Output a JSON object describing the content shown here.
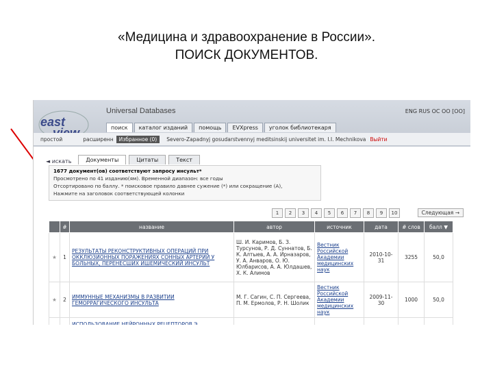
{
  "slide": {
    "title_line1": "«Медицина и здравоохранение в России».",
    "title_line2": "ПОИСК ДОКУМЕНТОВ."
  },
  "app": {
    "brand": "Universal Databases",
    "lang_line": "ENG RUS  ОС  ОО  [ОО]",
    "lang_selected": "RUS"
  },
  "nav_tabs": [
    "поиск",
    "каталог изданий",
    "помощь",
    "EVXpress",
    "уголок библиотекаря"
  ],
  "subbar": {
    "simple": "простой",
    "extended": "расширенн",
    "favorites": "Избранное (0)",
    "org": "Severo-Zapadnyj gosudarstvennyj meditsinskij universitet im. I.I. Mechnikova",
    "exit": "Выйти"
  },
  "result_tabs": {
    "back": "◄ искать",
    "items": [
      "Документы",
      "Цитаты",
      "Текст"
    ]
  },
  "results_info": {
    "line1": "1677 документ(ов) соответствуют запросу инсульт*",
    "line2": "Просмотрено по 41 изданию(ям). Временной диапазон: все годы",
    "line3": "Отсортировано по баллу. * поисковое правило давнее сужение (*) или сокращение (А),",
    "line4": "Нажмите на заголовок соответствующей колонки"
  },
  "pager": [
    "1",
    "2",
    "3",
    "4",
    "5",
    "6",
    "7",
    "8",
    "9",
    "10"
  ],
  "next_label": "Следующая →",
  "table": {
    "headers": [
      "",
      "#",
      "название",
      "автор",
      "источник",
      "дата",
      "# слов",
      "балл ▼"
    ],
    "rows": [
      {
        "num": "1",
        "title": "РЕЗУЛЬТАТЫ РЕКОНСТРУКТИВНЫХ ОПЕРАЦИЙ ПРИ ОККЛЮЗИОННЫХ ПОРАЖЕНИЯХ СОННЫХ АРТЕРИЙ У БОЛЬНЫХ, ПЕРЕНЕСШИХ ИШЕМИЧЕСКИЙ ИНСУЛЬТ",
        "author": "Ш. И. Каримов, Б. З. Турсунов, Р. Д. Суннатов, Б. К. Алтыев, А. А. Ирназаров, У. А. Анваров, О. Ю. Юлбарисов, А. А. Юлдашев, Х. К. Алимов",
        "source": "Вестник Российской Академии медицинских наук",
        "date": "2010-10-31",
        "words": "3255",
        "score": "50,0"
      },
      {
        "num": "2",
        "title": "ИММУННЫЕ МЕХАНИЗМЫ В РАЗВИТИИ ГЕМОРРАГИЧЕСКОГО ИНСУЛЬТА",
        "author": "М. Г. Сагин, С. П. Сергеева, П. М. Ермолов, Р. Н. Шолик",
        "source": "Вестник Российской Академии медицинских наук",
        "date": "2009-11-30",
        "words": "1000",
        "score": "50,0"
      },
      {
        "num": "",
        "title": "ИСПОЛЬЗОВАНИЕ НЕЙРОННЫХ РЕЦЕПТОРОВ Э",
        "author": "",
        "source": "",
        "date": "",
        "words": "",
        "score": ""
      }
    ]
  },
  "colors": {
    "header_bg": "#c9ced6",
    "table_head": "#6b6f74",
    "link": "#1a3f8c",
    "accent_red": "#cc0000"
  }
}
